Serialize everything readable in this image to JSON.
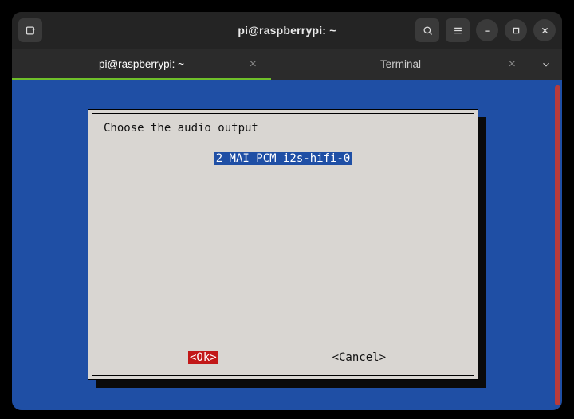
{
  "titlebar": {
    "title": "pi@raspberrypi: ~"
  },
  "tabs": {
    "items": [
      {
        "label": "pi@raspberrypi: ~",
        "active": true,
        "closable": true
      },
      {
        "label": "Terminal",
        "active": false,
        "closable": true
      }
    ]
  },
  "whiptail": {
    "prompt": "Choose the audio output",
    "options": [
      "2 MAI PCM i2s-hifi-0"
    ],
    "selected_index": 0,
    "buttons": {
      "ok": "<Ok>",
      "cancel": "<Cancel>"
    }
  },
  "colors": {
    "terminal_bg": "#1f4fa5",
    "dialog_bg": "#d9d6d2",
    "highlight_bg": "#1f4fa5",
    "ok_button_bg": "#c21818",
    "tab_active_underline": "#6fbf2a"
  }
}
